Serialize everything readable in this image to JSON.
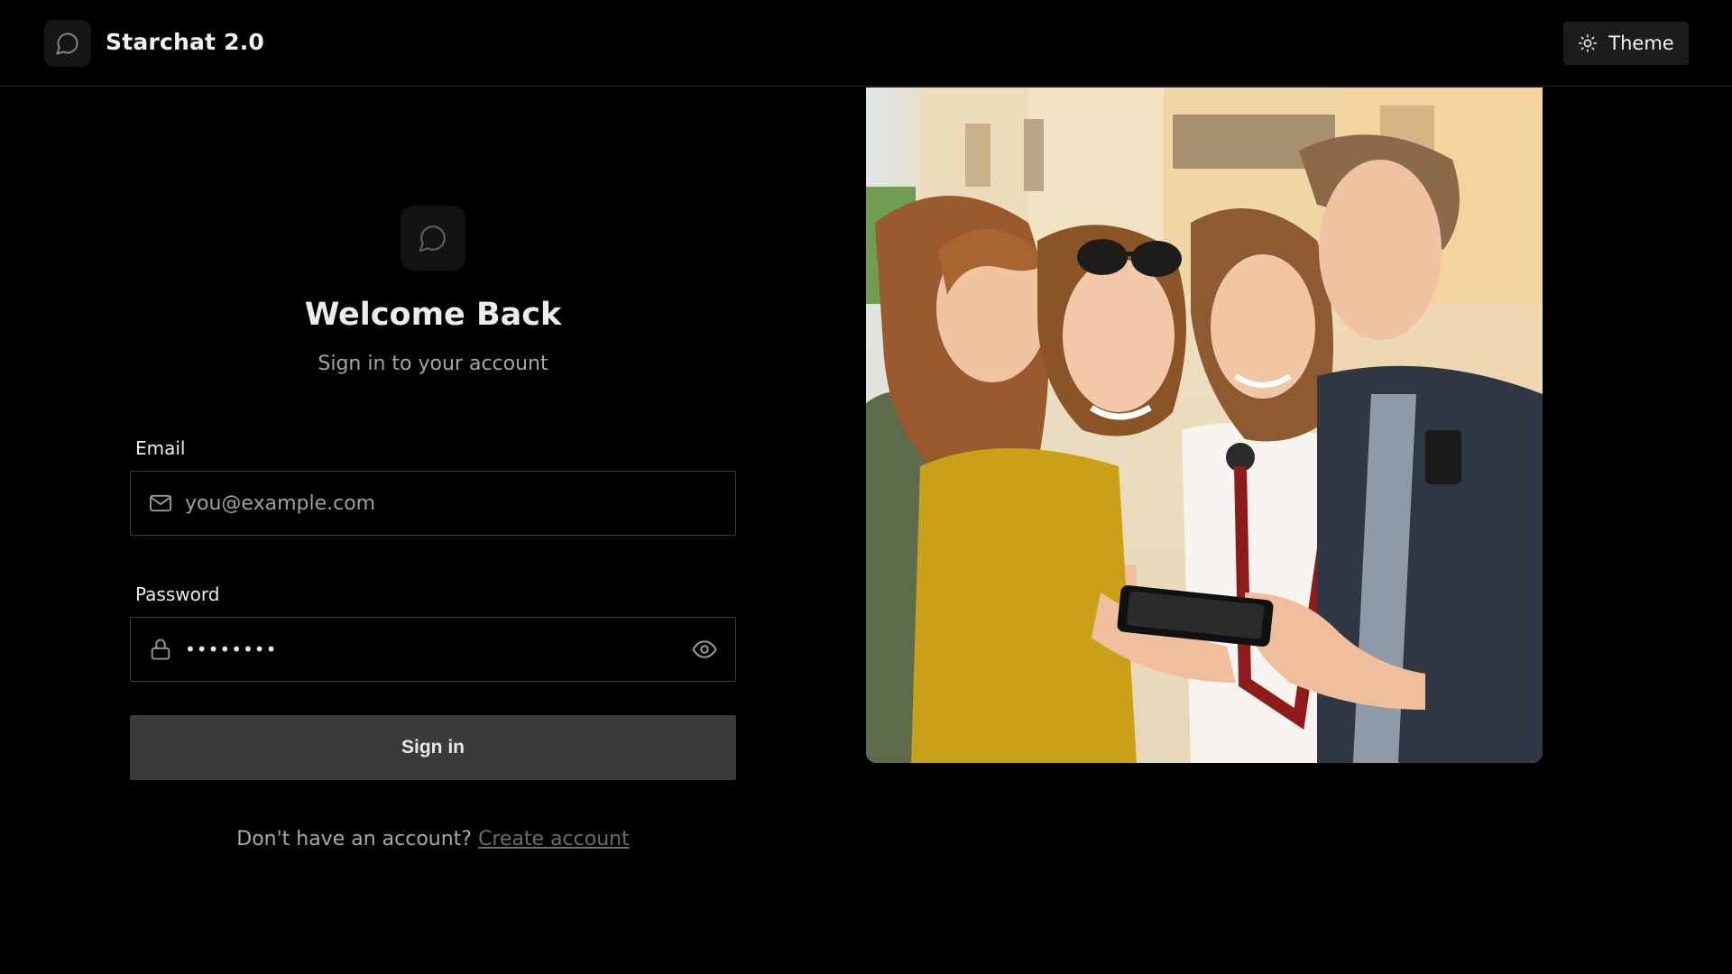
{
  "header": {
    "brand_name": "Starchat 2.0",
    "brand_icon": "chat-bubble-icon",
    "theme_label": "Theme",
    "theme_icon": "sun-icon"
  },
  "form": {
    "logo_icon": "chat-bubble-icon",
    "title": "Welcome Back",
    "subtitle": "Sign in to your account",
    "email": {
      "label": "Email",
      "placeholder": "you@example.com",
      "value": "",
      "icon": "mail-icon"
    },
    "password": {
      "label": "Password",
      "value": "••••••••",
      "icon": "lock-icon",
      "toggle_icon": "eye-icon"
    },
    "submit_label": "Sign in",
    "signup_prompt": "Don't have an account?",
    "signup_link": "Create account"
  },
  "hero": {
    "image_subject": "four-friends-looking-at-smartphone-photo"
  },
  "colors": {
    "background": "#000000",
    "header_border": "#2a2a2a",
    "button_bg": "#3a3a3a",
    "field_border": "#3d3d3d",
    "muted_text": "#a5a5a5",
    "link": "#6c6c6c"
  }
}
